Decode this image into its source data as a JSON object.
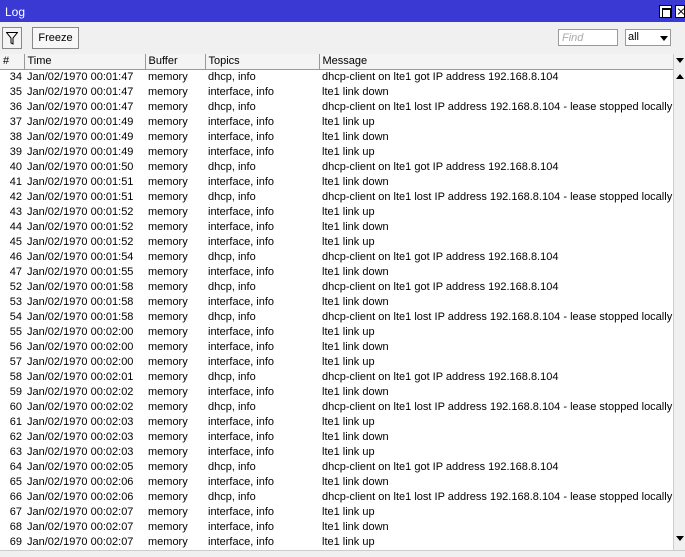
{
  "window": {
    "title": "Log"
  },
  "toolbar": {
    "freeze_label": "Freeze",
    "find_placeholder": "Find",
    "buffer_value": "all"
  },
  "columns": {
    "num": "#",
    "time": "Time",
    "buffer": "Buffer",
    "topics": "Topics",
    "message": "Message"
  },
  "rows": [
    {
      "num": "34",
      "time": "Jan/02/1970 00:01:47",
      "buffer": "memory",
      "topics": "dhcp, info",
      "message": "dhcp-client on lte1 got IP address 192.168.8.104"
    },
    {
      "num": "35",
      "time": "Jan/02/1970 00:01:47",
      "buffer": "memory",
      "topics": "interface, info",
      "message": "lte1 link down"
    },
    {
      "num": "36",
      "time": "Jan/02/1970 00:01:47",
      "buffer": "memory",
      "topics": "dhcp, info",
      "message": "dhcp-client on lte1 lost IP address 192.168.8.104 - lease stopped locally"
    },
    {
      "num": "37",
      "time": "Jan/02/1970 00:01:49",
      "buffer": "memory",
      "topics": "interface, info",
      "message": "lte1 link up"
    },
    {
      "num": "38",
      "time": "Jan/02/1970 00:01:49",
      "buffer": "memory",
      "topics": "interface, info",
      "message": "lte1 link down"
    },
    {
      "num": "39",
      "time": "Jan/02/1970 00:01:49",
      "buffer": "memory",
      "topics": "interface, info",
      "message": "lte1 link up"
    },
    {
      "num": "40",
      "time": "Jan/02/1970 00:01:50",
      "buffer": "memory",
      "topics": "dhcp, info",
      "message": "dhcp-client on lte1 got IP address 192.168.8.104"
    },
    {
      "num": "41",
      "time": "Jan/02/1970 00:01:51",
      "buffer": "memory",
      "topics": "interface, info",
      "message": "lte1 link down"
    },
    {
      "num": "42",
      "time": "Jan/02/1970 00:01:51",
      "buffer": "memory",
      "topics": "dhcp, info",
      "message": "dhcp-client on lte1 lost IP address 192.168.8.104 - lease stopped locally"
    },
    {
      "num": "43",
      "time": "Jan/02/1970 00:01:52",
      "buffer": "memory",
      "topics": "interface, info",
      "message": "lte1 link up"
    },
    {
      "num": "44",
      "time": "Jan/02/1970 00:01:52",
      "buffer": "memory",
      "topics": "interface, info",
      "message": "lte1 link down"
    },
    {
      "num": "45",
      "time": "Jan/02/1970 00:01:52",
      "buffer": "memory",
      "topics": "interface, info",
      "message": "lte1 link up"
    },
    {
      "num": "46",
      "time": "Jan/02/1970 00:01:54",
      "buffer": "memory",
      "topics": "dhcp, info",
      "message": "dhcp-client on lte1 got IP address 192.168.8.104"
    },
    {
      "num": "47",
      "time": "Jan/02/1970 00:01:55",
      "buffer": "memory",
      "topics": "interface, info",
      "message": "lte1 link down"
    },
    {
      "num": "52",
      "time": "Jan/02/1970 00:01:58",
      "buffer": "memory",
      "topics": "dhcp, info",
      "message": "dhcp-client on lte1 got IP address 192.168.8.104"
    },
    {
      "num": "53",
      "time": "Jan/02/1970 00:01:58",
      "buffer": "memory",
      "topics": "interface, info",
      "message": "lte1 link down"
    },
    {
      "num": "54",
      "time": "Jan/02/1970 00:01:58",
      "buffer": "memory",
      "topics": "dhcp, info",
      "message": "dhcp-client on lte1 lost IP address 192.168.8.104 - lease stopped locally"
    },
    {
      "num": "55",
      "time": "Jan/02/1970 00:02:00",
      "buffer": "memory",
      "topics": "interface, info",
      "message": "lte1 link up"
    },
    {
      "num": "56",
      "time": "Jan/02/1970 00:02:00",
      "buffer": "memory",
      "topics": "interface, info",
      "message": "lte1 link down"
    },
    {
      "num": "57",
      "time": "Jan/02/1970 00:02:00",
      "buffer": "memory",
      "topics": "interface, info",
      "message": "lte1 link up"
    },
    {
      "num": "58",
      "time": "Jan/02/1970 00:02:01",
      "buffer": "memory",
      "topics": "dhcp, info",
      "message": "dhcp-client on lte1 got IP address 192.168.8.104"
    },
    {
      "num": "59",
      "time": "Jan/02/1970 00:02:02",
      "buffer": "memory",
      "topics": "interface, info",
      "message": "lte1 link down"
    },
    {
      "num": "60",
      "time": "Jan/02/1970 00:02:02",
      "buffer": "memory",
      "topics": "dhcp, info",
      "message": "dhcp-client on lte1 lost IP address 192.168.8.104 - lease stopped locally"
    },
    {
      "num": "61",
      "time": "Jan/02/1970 00:02:03",
      "buffer": "memory",
      "topics": "interface, info",
      "message": "lte1 link up"
    },
    {
      "num": "62",
      "time": "Jan/02/1970 00:02:03",
      "buffer": "memory",
      "topics": "interface, info",
      "message": "lte1 link down"
    },
    {
      "num": "63",
      "time": "Jan/02/1970 00:02:03",
      "buffer": "memory",
      "topics": "interface, info",
      "message": "lte1 link up"
    },
    {
      "num": "64",
      "time": "Jan/02/1970 00:02:05",
      "buffer": "memory",
      "topics": "dhcp, info",
      "message": "dhcp-client on lte1 got IP address 192.168.8.104"
    },
    {
      "num": "65",
      "time": "Jan/02/1970 00:02:06",
      "buffer": "memory",
      "topics": "interface, info",
      "message": "lte1 link down"
    },
    {
      "num": "66",
      "time": "Jan/02/1970 00:02:06",
      "buffer": "memory",
      "topics": "dhcp, info",
      "message": "dhcp-client on lte1 lost IP address 192.168.8.104 - lease stopped locally"
    },
    {
      "num": "67",
      "time": "Jan/02/1970 00:02:07",
      "buffer": "memory",
      "topics": "interface, info",
      "message": "lte1 link up"
    },
    {
      "num": "68",
      "time": "Jan/02/1970 00:02:07",
      "buffer": "memory",
      "topics": "interface, info",
      "message": "lte1 link down"
    },
    {
      "num": "69",
      "time": "Jan/02/1970 00:02:07",
      "buffer": "memory",
      "topics": "interface, info",
      "message": "lte1 link up"
    }
  ]
}
